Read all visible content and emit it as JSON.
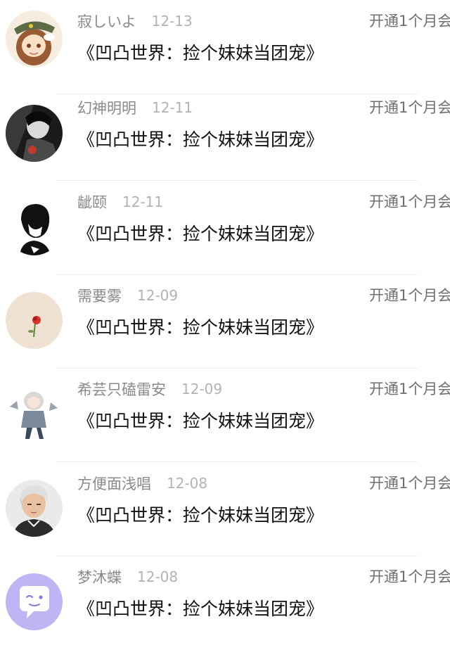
{
  "items": [
    {
      "username": "寂しいよ",
      "date": "12-13",
      "title": "《凹凸世界：捡个妹妹当团宠》",
      "status": "开通1个月会",
      "avatar_icon": "girl-hat-avatar-icon"
    },
    {
      "username": "幻神明明",
      "date": "12-11",
      "title": "《凹凸世界：捡个妹妹当团宠》",
      "status": "开通1个月会",
      "avatar_icon": "dark-figure-avatar-icon"
    },
    {
      "username": "龇颐",
      "date": "12-11",
      "title": "《凹凸世界：捡个妹妹当团宠》",
      "status": "开通1个月会",
      "avatar_icon": "boy-silhouette-avatar-icon"
    },
    {
      "username": "需要雾",
      "date": "12-09",
      "title": "《凹凸世界：捡个妹妹当团宠》",
      "status": "开通1个月会",
      "avatar_icon": "rose-avatar-icon"
    },
    {
      "username": "希芸只磕雷安",
      "date": "12-09",
      "title": "《凹凸世界：捡个妹妹当团宠》",
      "status": "开通1个月会",
      "avatar_icon": "chibi-character-avatar-icon"
    },
    {
      "username": "方便面浅唱",
      "date": "12-08",
      "title": "《凹凸世界：捡个妹妹当团宠》",
      "status": "开通1个月会",
      "avatar_icon": "man-portrait-avatar-icon"
    },
    {
      "username": "梦沐蝶",
      "date": "12-08",
      "title": "《凹凸世界：捡个妹妹当团宠》",
      "status": "开通1个月会",
      "avatar_icon": "chat-bubble-avatar-icon"
    }
  ]
}
